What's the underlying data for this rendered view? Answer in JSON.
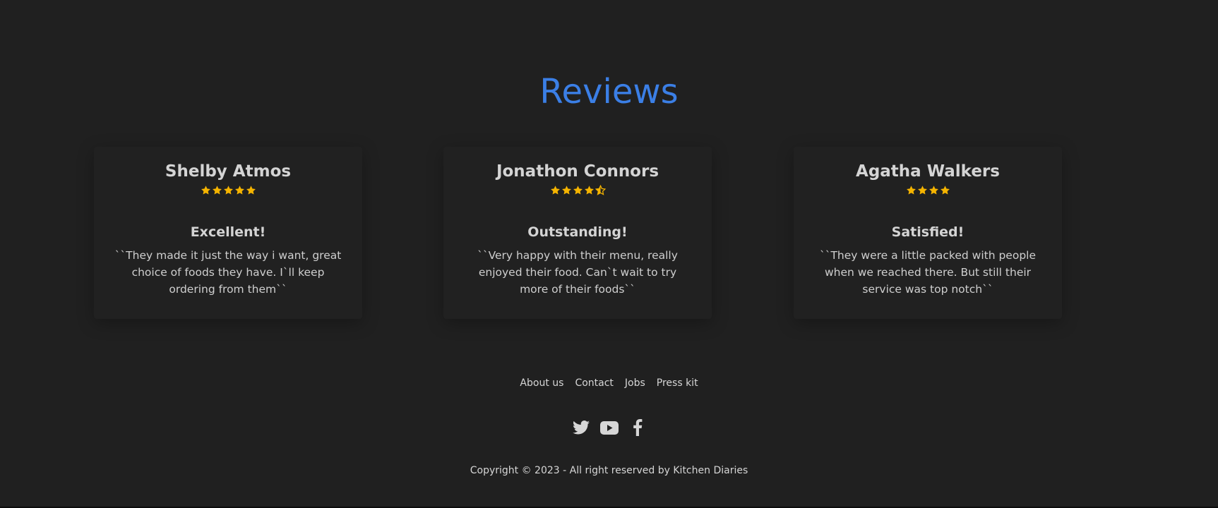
{
  "section": {
    "title": "Reviews"
  },
  "colors": {
    "accent": "#3b7fe6",
    "star": "#f5b400",
    "background": "#202020"
  },
  "reviews": [
    {
      "name": "Shelby Atmos",
      "rating": 5,
      "headline": "Excellent!",
      "text": "``They made it just the way i want, great choice of foods they have. I`ll keep ordering from them``"
    },
    {
      "name": "Jonathon Connors",
      "rating": 4.5,
      "headline": "Outstanding!",
      "text": "``Very happy with their menu, really enjoyed their food. Can`t wait to try more of their foods``"
    },
    {
      "name": "Agatha Walkers",
      "rating": 4,
      "headline": "Satisfied!",
      "text": "``They were a little packed with people when we reached there. But still their service was top notch``"
    }
  ],
  "footer": {
    "links": [
      "About us",
      "Contact",
      "Jobs",
      "Press kit"
    ],
    "social": [
      "twitter-icon",
      "youtube-icon",
      "facebook-icon"
    ],
    "copyright": "Copyright © 2023 - All right reserved by Kitchen Diaries"
  }
}
